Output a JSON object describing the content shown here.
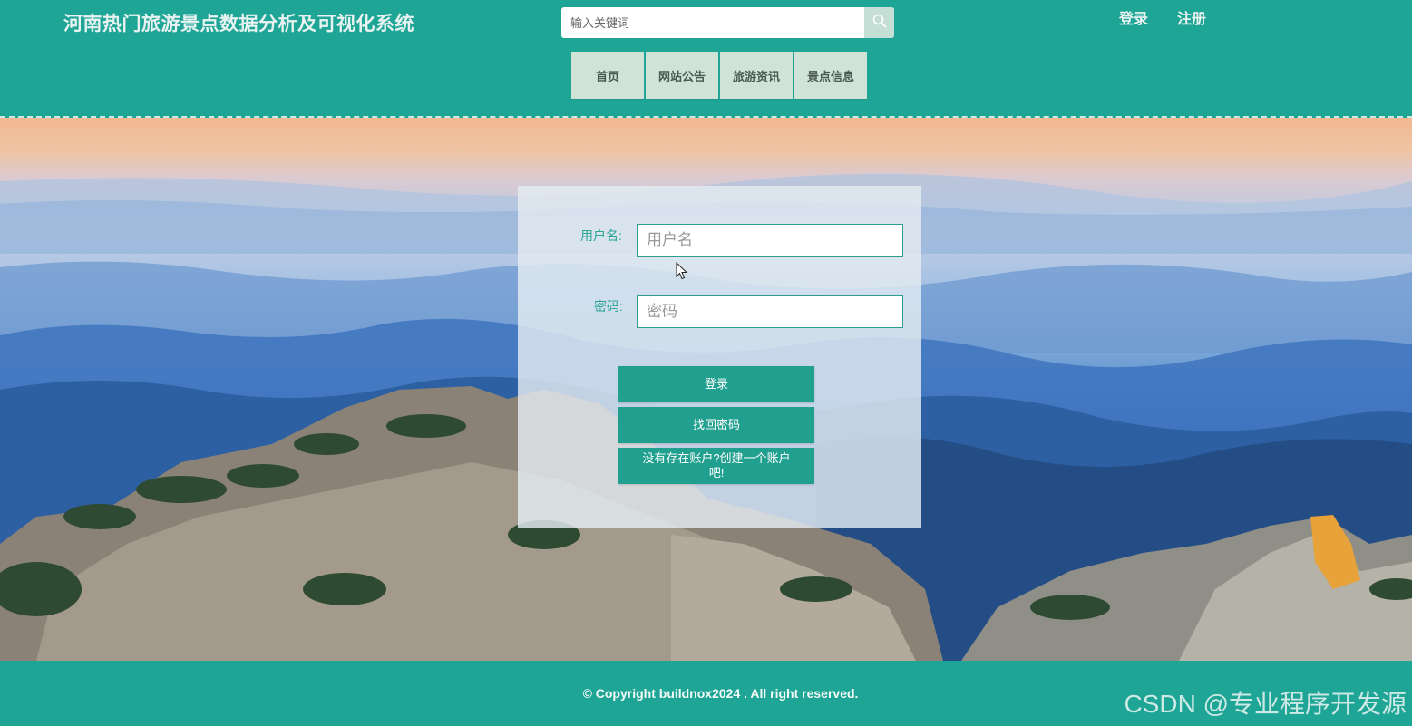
{
  "header": {
    "site_title": "河南热门旅游景点数据分析及可视化系统",
    "search_placeholder": "输入关键词",
    "login_link": "登录",
    "register_link": "注册"
  },
  "nav": {
    "items": [
      {
        "label": "首页"
      },
      {
        "label": "网站公告"
      },
      {
        "label": "旅游资讯"
      },
      {
        "label": "景点信息"
      }
    ]
  },
  "login_form": {
    "username_label": "用户名:",
    "username_placeholder": "用户名",
    "password_label": "密码:",
    "password_placeholder": "密码",
    "login_button": "登录",
    "find_password_button": "找回密码",
    "register_button": "没有存在账户?创建一个账户吧!"
  },
  "footer": {
    "copyright": "© Copyright buildnox2024 . All right reserved.",
    "watermark": "CSDN @专业程序开发源"
  },
  "colors": {
    "primary": "#1ea596",
    "nav_item_bg": "#cfe4d7",
    "button": "#22a08f"
  },
  "icons": {
    "search": "search-icon",
    "cursor": "mouse-cursor-icon"
  }
}
